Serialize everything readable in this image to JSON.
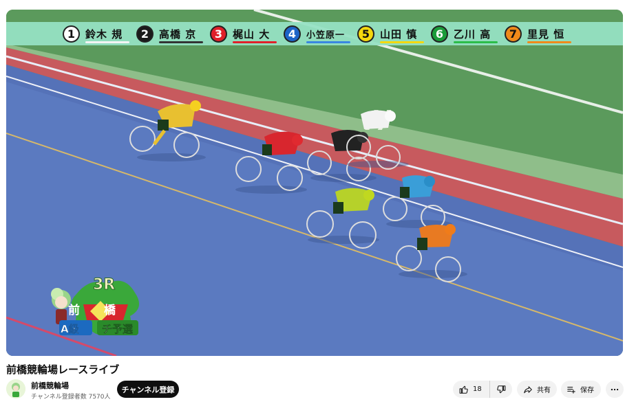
{
  "video": {
    "title": "前橋競輪場レースライブ"
  },
  "banner": {
    "riders": [
      {
        "number": "1",
        "name": "鈴木 規",
        "bg": "#ffffff",
        "fg": "#111111",
        "bar": "#f4f4f4"
      },
      {
        "number": "2",
        "name": "高橋 京",
        "bg": "#1a1a1a",
        "fg": "#ffffff",
        "bar": "#333333"
      },
      {
        "number": "3",
        "name": "梶山 大",
        "bg": "#e0202a",
        "fg": "#ffffff",
        "bar": "#e0202a"
      },
      {
        "number": "4",
        "name": "小笠原一",
        "bg": "#1d64c8",
        "fg": "#ffffff",
        "bar": "#3a86e0"
      },
      {
        "number": "5",
        "name": "山田 慎",
        "bg": "#f5d80e",
        "fg": "#111111",
        "bar": "#f5d80e"
      },
      {
        "number": "6",
        "name": "乙川 高",
        "bg": "#1a9c3a",
        "fg": "#ffffff",
        "bar": "#2bbd4a"
      },
      {
        "number": "7",
        "name": "里見 恒",
        "bg": "#f08a1a",
        "fg": "#111111",
        "bar": "#f08a1a"
      }
    ]
  },
  "overlay": {
    "race_number": "3R",
    "venue_left": "前",
    "venue_right": "橋",
    "grade": "A級",
    "race_type": "チ予選"
  },
  "channel": {
    "name": "前橋競輪場",
    "subscribers": "チャンネル登録者数 7570人",
    "subscribe_label": "チャンネル登録"
  },
  "actions": {
    "like_count": "18",
    "share_label": "共有",
    "save_label": "保存"
  },
  "icons": {
    "like": "thumbs-up-icon",
    "dislike": "thumbs-down-icon",
    "share": "share-arrow-icon",
    "save": "save-playlist-icon",
    "more": "more-horizontal-icon"
  }
}
